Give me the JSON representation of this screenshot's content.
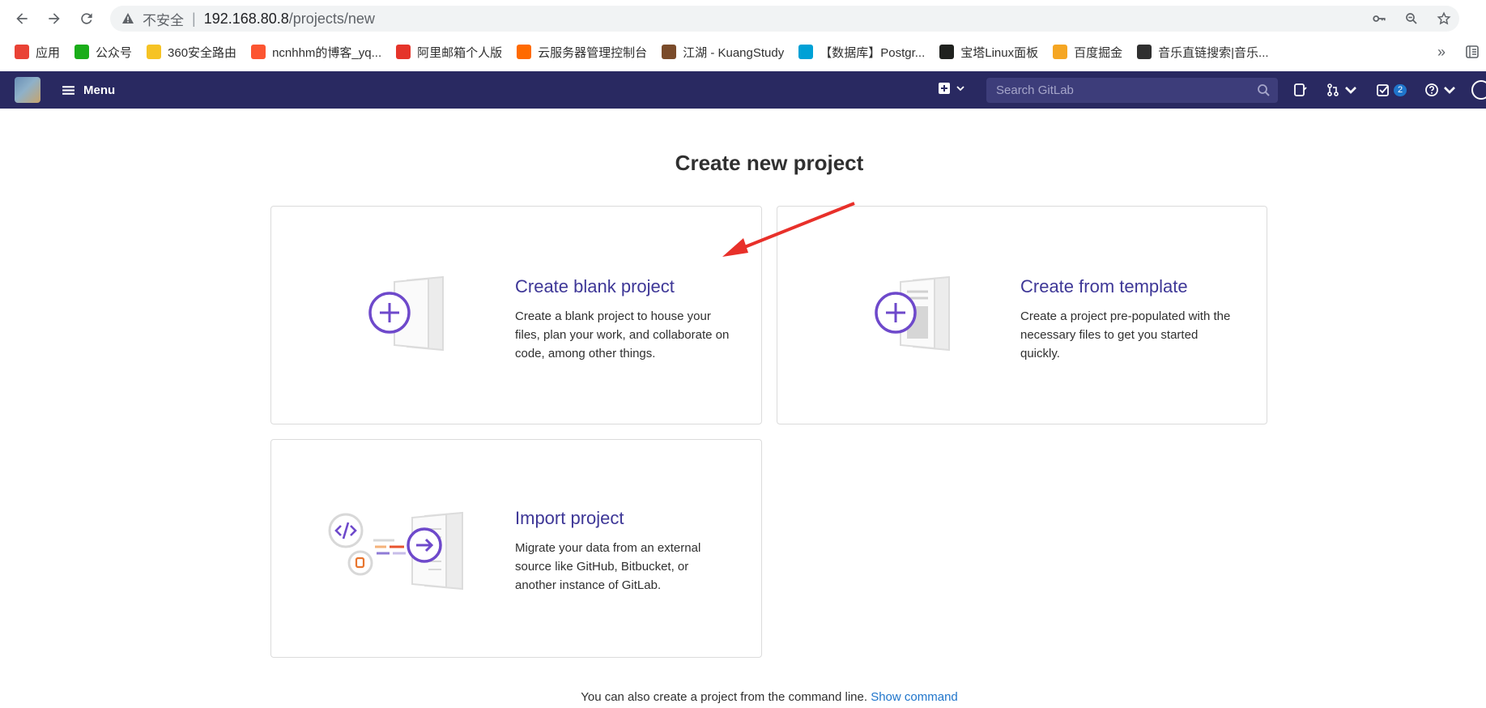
{
  "browser": {
    "security_label": "不安全",
    "url_host": "192.168.80.8",
    "url_path": "/projects/new"
  },
  "bookmarks": [
    {
      "label": "应用",
      "icon": "apps-grid-icon",
      "color": "#e94235"
    },
    {
      "label": "公众号",
      "icon": "wechat-icon",
      "color": "#1aad19"
    },
    {
      "label": "360安全路由",
      "icon": "360-icon",
      "color": "#f6c324"
    },
    {
      "label": "ncnhhm的博客_yq...",
      "icon": "csdn-icon",
      "color": "#fc5531"
    },
    {
      "label": "阿里邮箱个人版",
      "icon": "ali-mail-icon",
      "color": "#e5342a"
    },
    {
      "label": "云服务器管理控制台",
      "icon": "aliyun-icon",
      "color": "#ff6a00"
    },
    {
      "label": "江湖 - KuangStudy",
      "icon": "avatar-icon",
      "color": "#7a4b2a"
    },
    {
      "label": "【数据库】Postgr...",
      "icon": "bilibili-icon",
      "color": "#00a1d6"
    },
    {
      "label": "宝塔Linux面板",
      "icon": "bt-icon",
      "color": "#20221f"
    },
    {
      "label": "百度掘金",
      "icon": "juejin-icon",
      "color": "#f5a623"
    },
    {
      "label": "音乐直链搜索|音乐...",
      "icon": "liu-icon",
      "color": "#303030"
    }
  ],
  "bookmarks_more": "»",
  "gitlab": {
    "menu_label": "Menu",
    "search_placeholder": "Search GitLab",
    "todo_count": "2"
  },
  "page": {
    "title": "Create new project",
    "cards": {
      "blank": {
        "title": "Create blank project",
        "description": "Create a blank project to house your files, plan your work, and collaborate on code, among other things."
      },
      "template": {
        "title": "Create from template",
        "description": "Create a project pre-populated with the necessary files to get you started quickly."
      },
      "import": {
        "title": "Import project",
        "description": "Migrate your data from an external source like GitHub, Bitbucket, or another instance of GitLab."
      }
    },
    "footer_text": "You can also create a project from the command line.",
    "footer_link": "Show command"
  },
  "colors": {
    "nav_bg": "#292961",
    "accent_purple": "#6e49cb",
    "title_purple": "#3e3797",
    "link_blue": "#1f75cb",
    "annotation_red": "#e8302a"
  }
}
